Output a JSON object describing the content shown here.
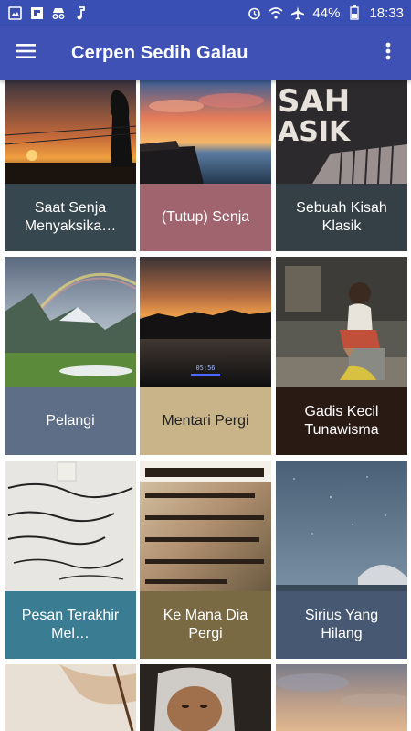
{
  "status": {
    "battery": "44%",
    "time": "18:33"
  },
  "app": {
    "title": "Cerpen Sedih Galau"
  },
  "stories": [
    {
      "title": "Saat Senja Menyaksika…",
      "caption_color": "#37474f"
    },
    {
      "title": "(Tutup) Senja",
      "caption_color": "#a0646e"
    },
    {
      "title": "Sebuah Kisah Klasik",
      "caption_color": "#344046"
    },
    {
      "title": "Pelangi",
      "caption_color": "#5e6e86"
    },
    {
      "title": "Mentari Pergi",
      "caption_color": "#c9b48a"
    },
    {
      "title": "Gadis Kecil Tunawisma",
      "caption_color": "#2a1a14"
    },
    {
      "title": "Pesan Terakhir Mel…",
      "caption_color": "#3a7d92"
    },
    {
      "title": "Ke Mana Dia Pergi",
      "caption_color": "#7a6a44"
    },
    {
      "title": "Sirius Yang Hilang",
      "caption_color": "#465872"
    }
  ],
  "partial_row": [
    {
      "name": "hand-writing-image"
    },
    {
      "name": "elderly-woman-image"
    },
    {
      "name": "cloudy-sky-image"
    }
  ]
}
